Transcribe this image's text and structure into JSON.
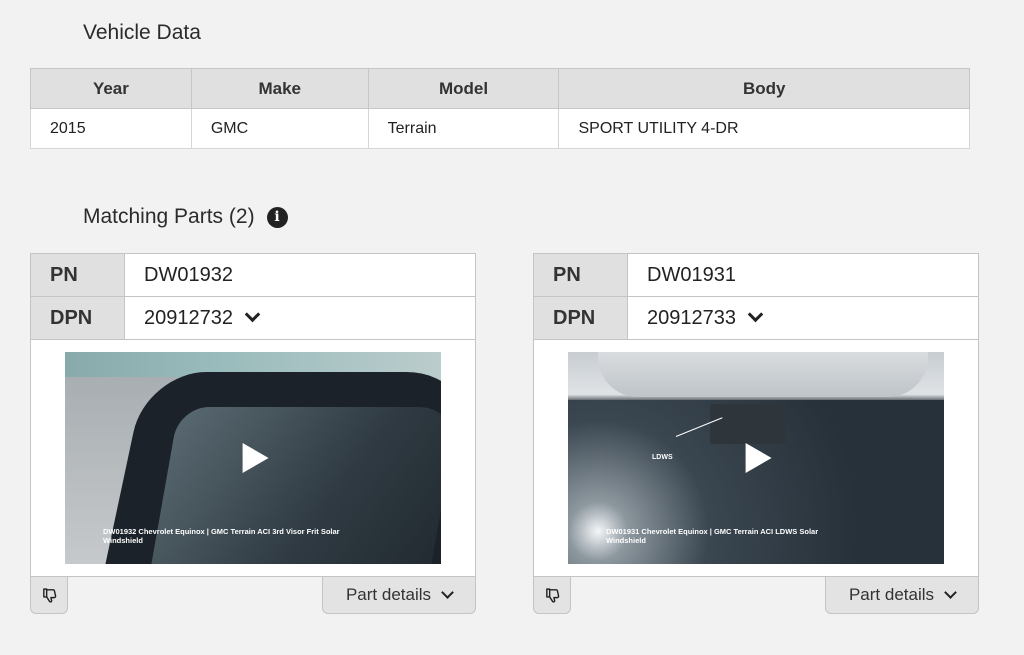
{
  "vehicle": {
    "title": "Vehicle Data",
    "headers": [
      "Year",
      "Make",
      "Model",
      "Body"
    ],
    "row": [
      "2015",
      "GMC",
      "Terrain",
      "SPORT UTILITY 4-DR"
    ]
  },
  "parts": {
    "title": "Matching Parts (2)",
    "info_icon": "info-icon",
    "pn_label": "PN",
    "dpn_label": "DPN",
    "details_label": "Part details",
    "feedback_icon": "thumbs-down-icon",
    "items": [
      {
        "pn": "DW01932",
        "dpn": "20912732",
        "caption_line1": "DW01932 Chevrolet Equinox | GMC Terrain ACI 3rd Visor Frit Solar",
        "caption_line2": "Windshield"
      },
      {
        "pn": "DW01931",
        "dpn": "20912733",
        "caption_line1": "DW01931 Chevrolet Equinox | GMC Terrain ACI LDWS Solar",
        "caption_line2": "Windshield",
        "overlay_label": "LDWS"
      }
    ]
  }
}
